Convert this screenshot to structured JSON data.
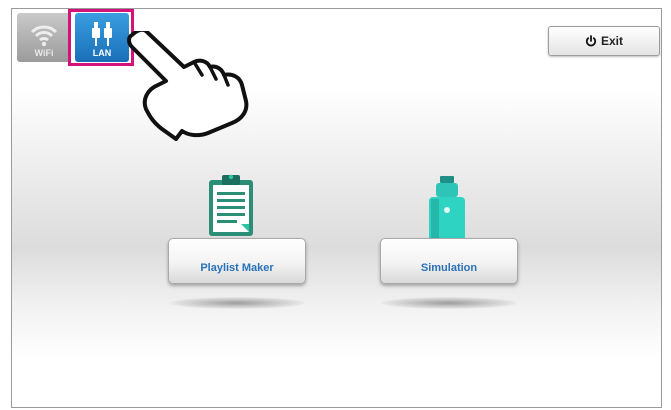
{
  "network": {
    "wifi_label": "WiFi",
    "lan_label": "LAN",
    "wifi_icon": "wifi-icon",
    "lan_icon": "lan-plug-icon"
  },
  "exit": {
    "label": "Exit",
    "icon": "power-icon"
  },
  "apps": {
    "playlist": {
      "label": "Playlist Maker",
      "icon": "clipboard-icon"
    },
    "simulation": {
      "label": "Simulation",
      "icon": "device-icon"
    }
  },
  "colors": {
    "highlight": "#d4137a",
    "lan_active": "#1f80c8",
    "wifi_inactive": "#a8a8a8",
    "accent_teal": "#2ec4a8",
    "label_blue": "#2a72b8"
  }
}
